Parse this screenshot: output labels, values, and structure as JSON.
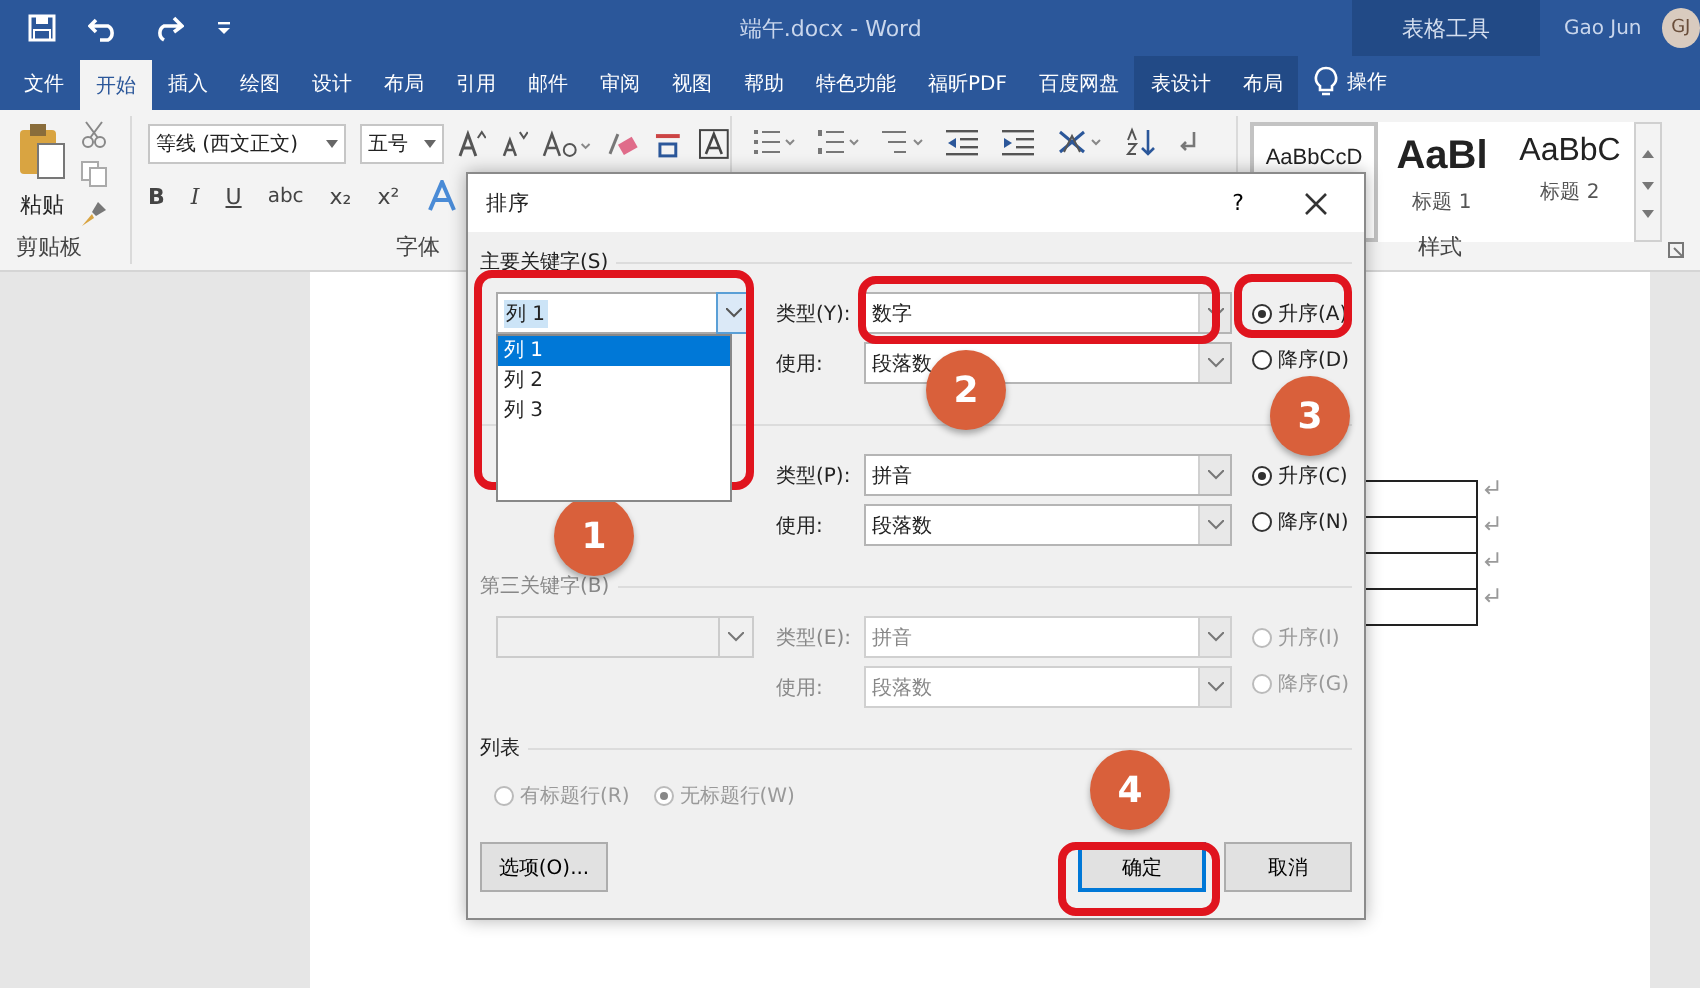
{
  "title_bar": {
    "document_title": "端午.docx - Word",
    "context_label": "表格工具",
    "user": "Gao Jun",
    "avatar_initials": "GJ"
  },
  "ribbon_tabs": [
    {
      "label": "文件",
      "selected": false,
      "context": false
    },
    {
      "label": "开始",
      "selected": true,
      "context": false
    },
    {
      "label": "插入",
      "selected": false,
      "context": false
    },
    {
      "label": "绘图",
      "selected": false,
      "context": false
    },
    {
      "label": "设计",
      "selected": false,
      "context": false
    },
    {
      "label": "布局",
      "selected": false,
      "context": false
    },
    {
      "label": "引用",
      "selected": false,
      "context": false
    },
    {
      "label": "邮件",
      "selected": false,
      "context": false
    },
    {
      "label": "审阅",
      "selected": false,
      "context": false
    },
    {
      "label": "视图",
      "selected": false,
      "context": false
    },
    {
      "label": "帮助",
      "selected": false,
      "context": false
    },
    {
      "label": "特色功能",
      "selected": false,
      "context": false
    },
    {
      "label": "福昕PDF",
      "selected": false,
      "context": false
    },
    {
      "label": "百度网盘",
      "selected": false,
      "context": false
    },
    {
      "label": "表设计",
      "selected": false,
      "context": true
    },
    {
      "label": "布局",
      "selected": false,
      "context": true
    }
  ],
  "tell_me": "操作",
  "ribbon": {
    "clipboard": {
      "paste": "粘贴",
      "group_label": "剪贴板"
    },
    "font": {
      "font_name": "等线 (西文正文)",
      "font_size": "五号",
      "format_buttons": [
        {
          "label": "B",
          "kind": "bold"
        },
        {
          "label": "I",
          "kind": "italic"
        },
        {
          "label": "U",
          "kind": "underline"
        },
        {
          "label": "abc",
          "kind": "strike"
        },
        {
          "label": "x₂",
          "kind": "plain"
        },
        {
          "label": "x²",
          "kind": "plain"
        }
      ],
      "group_label": "字体"
    },
    "styles": {
      "items": [
        {
          "preview": "AaBbCcD",
          "selected": true,
          "kind": "normal"
        },
        {
          "preview": "AaBl",
          "name": "标题 1",
          "selected": false,
          "kind": "heading1"
        },
        {
          "preview": "AaBbC",
          "name": "标题 2",
          "selected": false,
          "kind": "heading2"
        }
      ],
      "group_label": "样式"
    }
  },
  "dialog": {
    "title": "排序",
    "help": "?",
    "primary": {
      "label": "主要关键字(S)",
      "value": "列 1",
      "options": [
        {
          "label": "列 1",
          "selected": true
        },
        {
          "label": "列 2",
          "selected": false
        },
        {
          "label": "列 3",
          "selected": false
        }
      ],
      "type_label": "类型(Y):",
      "type_value": "数字",
      "using_label": "使用:",
      "using_value": "段落数",
      "ascending": {
        "label": "升序(A)",
        "selected": true
      },
      "descending": {
        "label": "降序(D)",
        "selected": false
      }
    },
    "secondary": {
      "type_label": "类型(P):",
      "type_value": "拼音",
      "using_label": "使用:",
      "using_value": "段落数",
      "ascending": {
        "label": "升序(C)",
        "selected": true
      },
      "descending": {
        "label": "降序(N)",
        "selected": false
      }
    },
    "tertiary": {
      "label": "第三关键字(B)",
      "disabled": true,
      "type_label": "类型(E):",
      "type_value": "拼音",
      "using_label": "使用:",
      "using_value": "段落数",
      "ascending": {
        "label": "升序(I)",
        "selected": false
      },
      "descending": {
        "label": "降序(G)",
        "selected": false
      }
    },
    "list": {
      "label": "列表",
      "disabled": true,
      "options": [
        {
          "label": "有标题行(R)",
          "selected": false
        },
        {
          "label": "无标题行(W)",
          "selected": true
        }
      ]
    },
    "buttons": [
      {
        "label": "选项(O)...",
        "default": false
      },
      {
        "label": "确定",
        "default": true
      },
      {
        "label": "取消",
        "default": false
      }
    ]
  },
  "annotations": [
    "1",
    "2",
    "3",
    "4"
  ]
}
